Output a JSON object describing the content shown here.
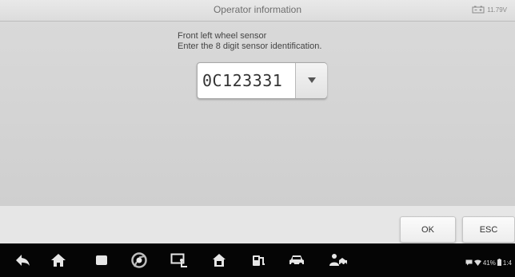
{
  "header": {
    "title": "Operator information",
    "battery_voltage": "11.79V"
  },
  "prompt": {
    "line1": "Front left wheel sensor",
    "line2": "Enter the 8 digit sensor identification."
  },
  "sensor_id": {
    "value": "0C123331"
  },
  "footer": {
    "ok_label": "OK",
    "esc_label": "ESC"
  },
  "navbar": {
    "icons": [
      "back-icon",
      "home-icon",
      "recent-apps-icon",
      "chrome-icon",
      "screenshot-icon",
      "vci-home-icon",
      "service-car-icon",
      "car-icon",
      "support-icon"
    ]
  },
  "status_bar": {
    "battery_percent": "41%",
    "clock": "1:4"
  }
}
